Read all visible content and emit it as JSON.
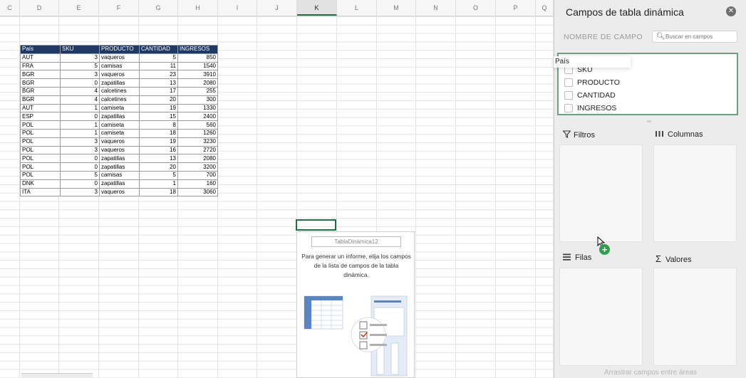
{
  "columns": [
    "C",
    "D",
    "E",
    "F",
    "G",
    "H",
    "I",
    "J",
    "K",
    "L",
    "M",
    "N",
    "O",
    "P",
    "Q"
  ],
  "selected_column": "K",
  "table": {
    "headers": [
      "País",
      "SKU",
      "PRODUCTO",
      "CANTIDAD",
      "INGRESOS"
    ],
    "rows": [
      [
        "AUT",
        "3",
        "vaqueros",
        "5",
        "850"
      ],
      [
        "FRA",
        "5",
        "camisas",
        "11",
        "1540"
      ],
      [
        "BGR",
        "3",
        "vaqueros",
        "23",
        "3910"
      ],
      [
        "BGR",
        "0",
        "zapatillas",
        "13",
        "2080"
      ],
      [
        "BGR",
        "4",
        "calcetines",
        "17",
        "255"
      ],
      [
        "BGR",
        "4",
        "calcetines",
        "20",
        "300"
      ],
      [
        "AUT",
        "1",
        "camiseta",
        "19",
        "1330"
      ],
      [
        "ESP",
        "0",
        "zapatillas",
        "15",
        "2400"
      ],
      [
        "POL",
        "1",
        "camiseta",
        "8",
        "560"
      ],
      [
        "POL",
        "1",
        "camiseta",
        "18",
        "1260"
      ],
      [
        "POL",
        "3",
        "vaqueros",
        "19",
        "3230"
      ],
      [
        "POL",
        "3",
        "vaqueros",
        "16",
        "2720"
      ],
      [
        "POL",
        "0",
        "zapatillas",
        "13",
        "2080"
      ],
      [
        "POL",
        "0",
        "zapatillas",
        "20",
        "3200"
      ],
      [
        "POL",
        "5",
        "camisas",
        "5",
        "700"
      ],
      [
        "DNK",
        "0",
        "zapatillas",
        "1",
        "160"
      ],
      [
        "ITA",
        "3",
        "vaqueros",
        "18",
        "3060"
      ]
    ]
  },
  "pivot_placeholder": {
    "name": "TablaDinámica12",
    "message": "Para generar un informe, elija los campos de la lista de campos de la tabla dinámica."
  },
  "panel": {
    "title": "Campos de tabla dinámica",
    "field_name_label": "NOMBRE DE CAMPO",
    "search_placeholder": "Buscar en campos",
    "dragging_field": "País",
    "fields": [
      "SKU",
      "PRODUCTO",
      "CANTIDAD",
      "INGRESOS"
    ],
    "areas": {
      "filters": "Filtros",
      "columns": "Columnas",
      "rows": "Filas",
      "values": "Valores"
    },
    "footer": "Arrastrar campos entre áreas"
  },
  "colors": {
    "table_header": "#1f3864",
    "selection": "#1e7145",
    "add_badge": "#2e9e4a"
  }
}
